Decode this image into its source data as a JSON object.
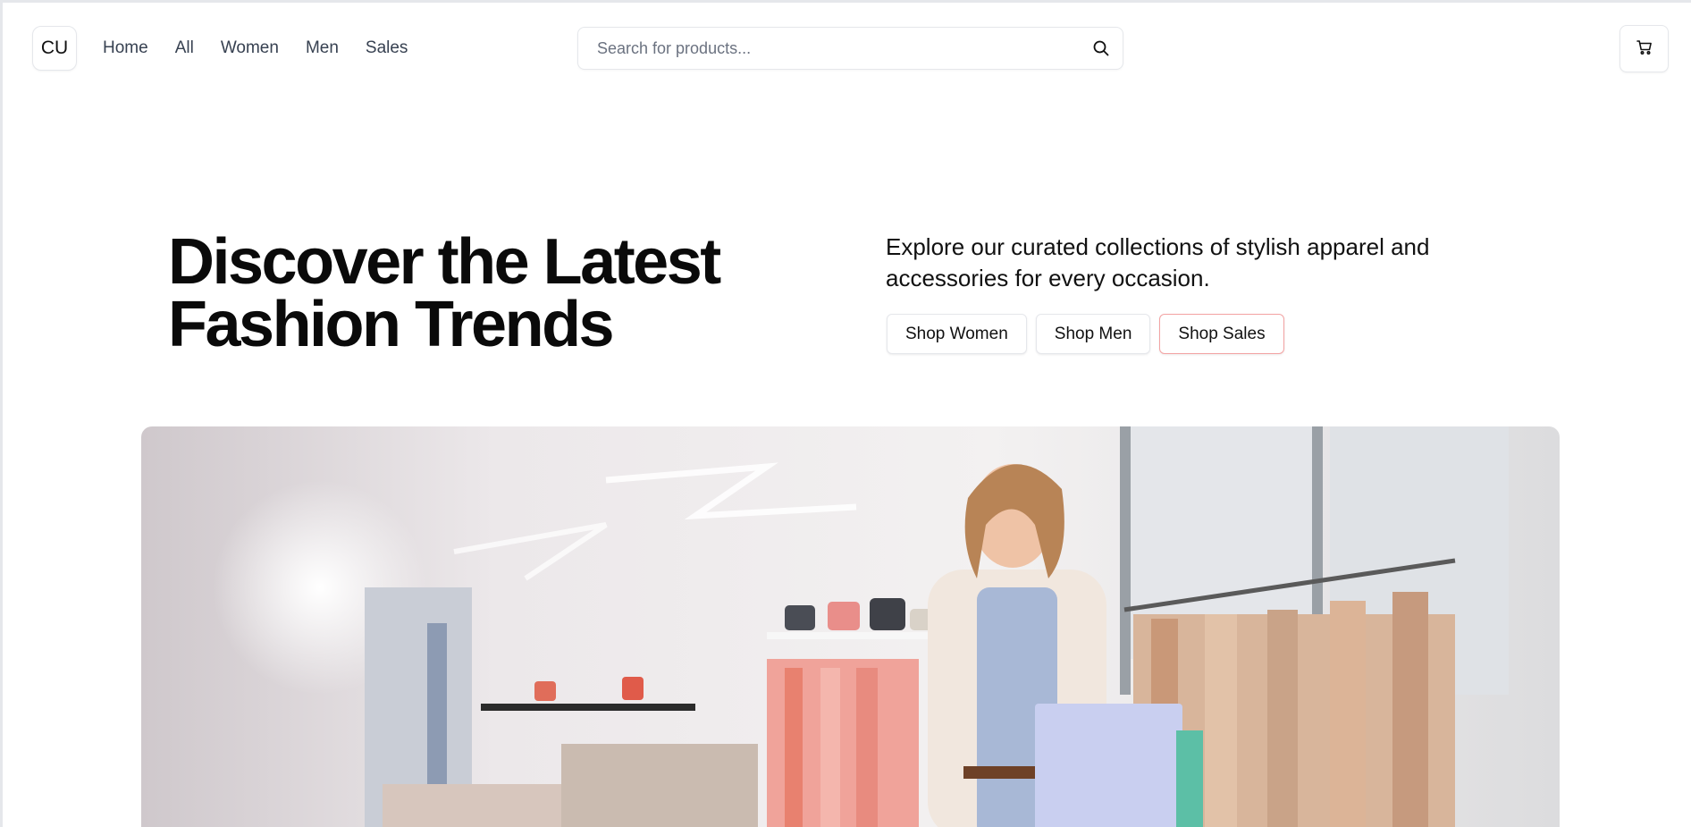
{
  "header": {
    "logo_text": "CU",
    "nav": [
      {
        "label": "Home"
      },
      {
        "label": "All"
      },
      {
        "label": "Women"
      },
      {
        "label": "Men"
      },
      {
        "label": "Sales"
      }
    ],
    "search": {
      "value": "",
      "placeholder": "Search for products..."
    },
    "icons": {
      "search": "search-icon",
      "cart": "shopping-cart-icon"
    }
  },
  "hero": {
    "title_line1": "Discover the Latest",
    "title_line2": "Fashion Trends",
    "description": "Explore our curated collections of stylish apparel and accessories for every occasion.",
    "buttons": {
      "women": "Shop Women",
      "men": "Shop Men",
      "sales": "Shop Sales"
    }
  },
  "colors": {
    "text": "#0a0a0a",
    "border": "#e5e7eb",
    "sales_accent": "#f3a3a3"
  }
}
